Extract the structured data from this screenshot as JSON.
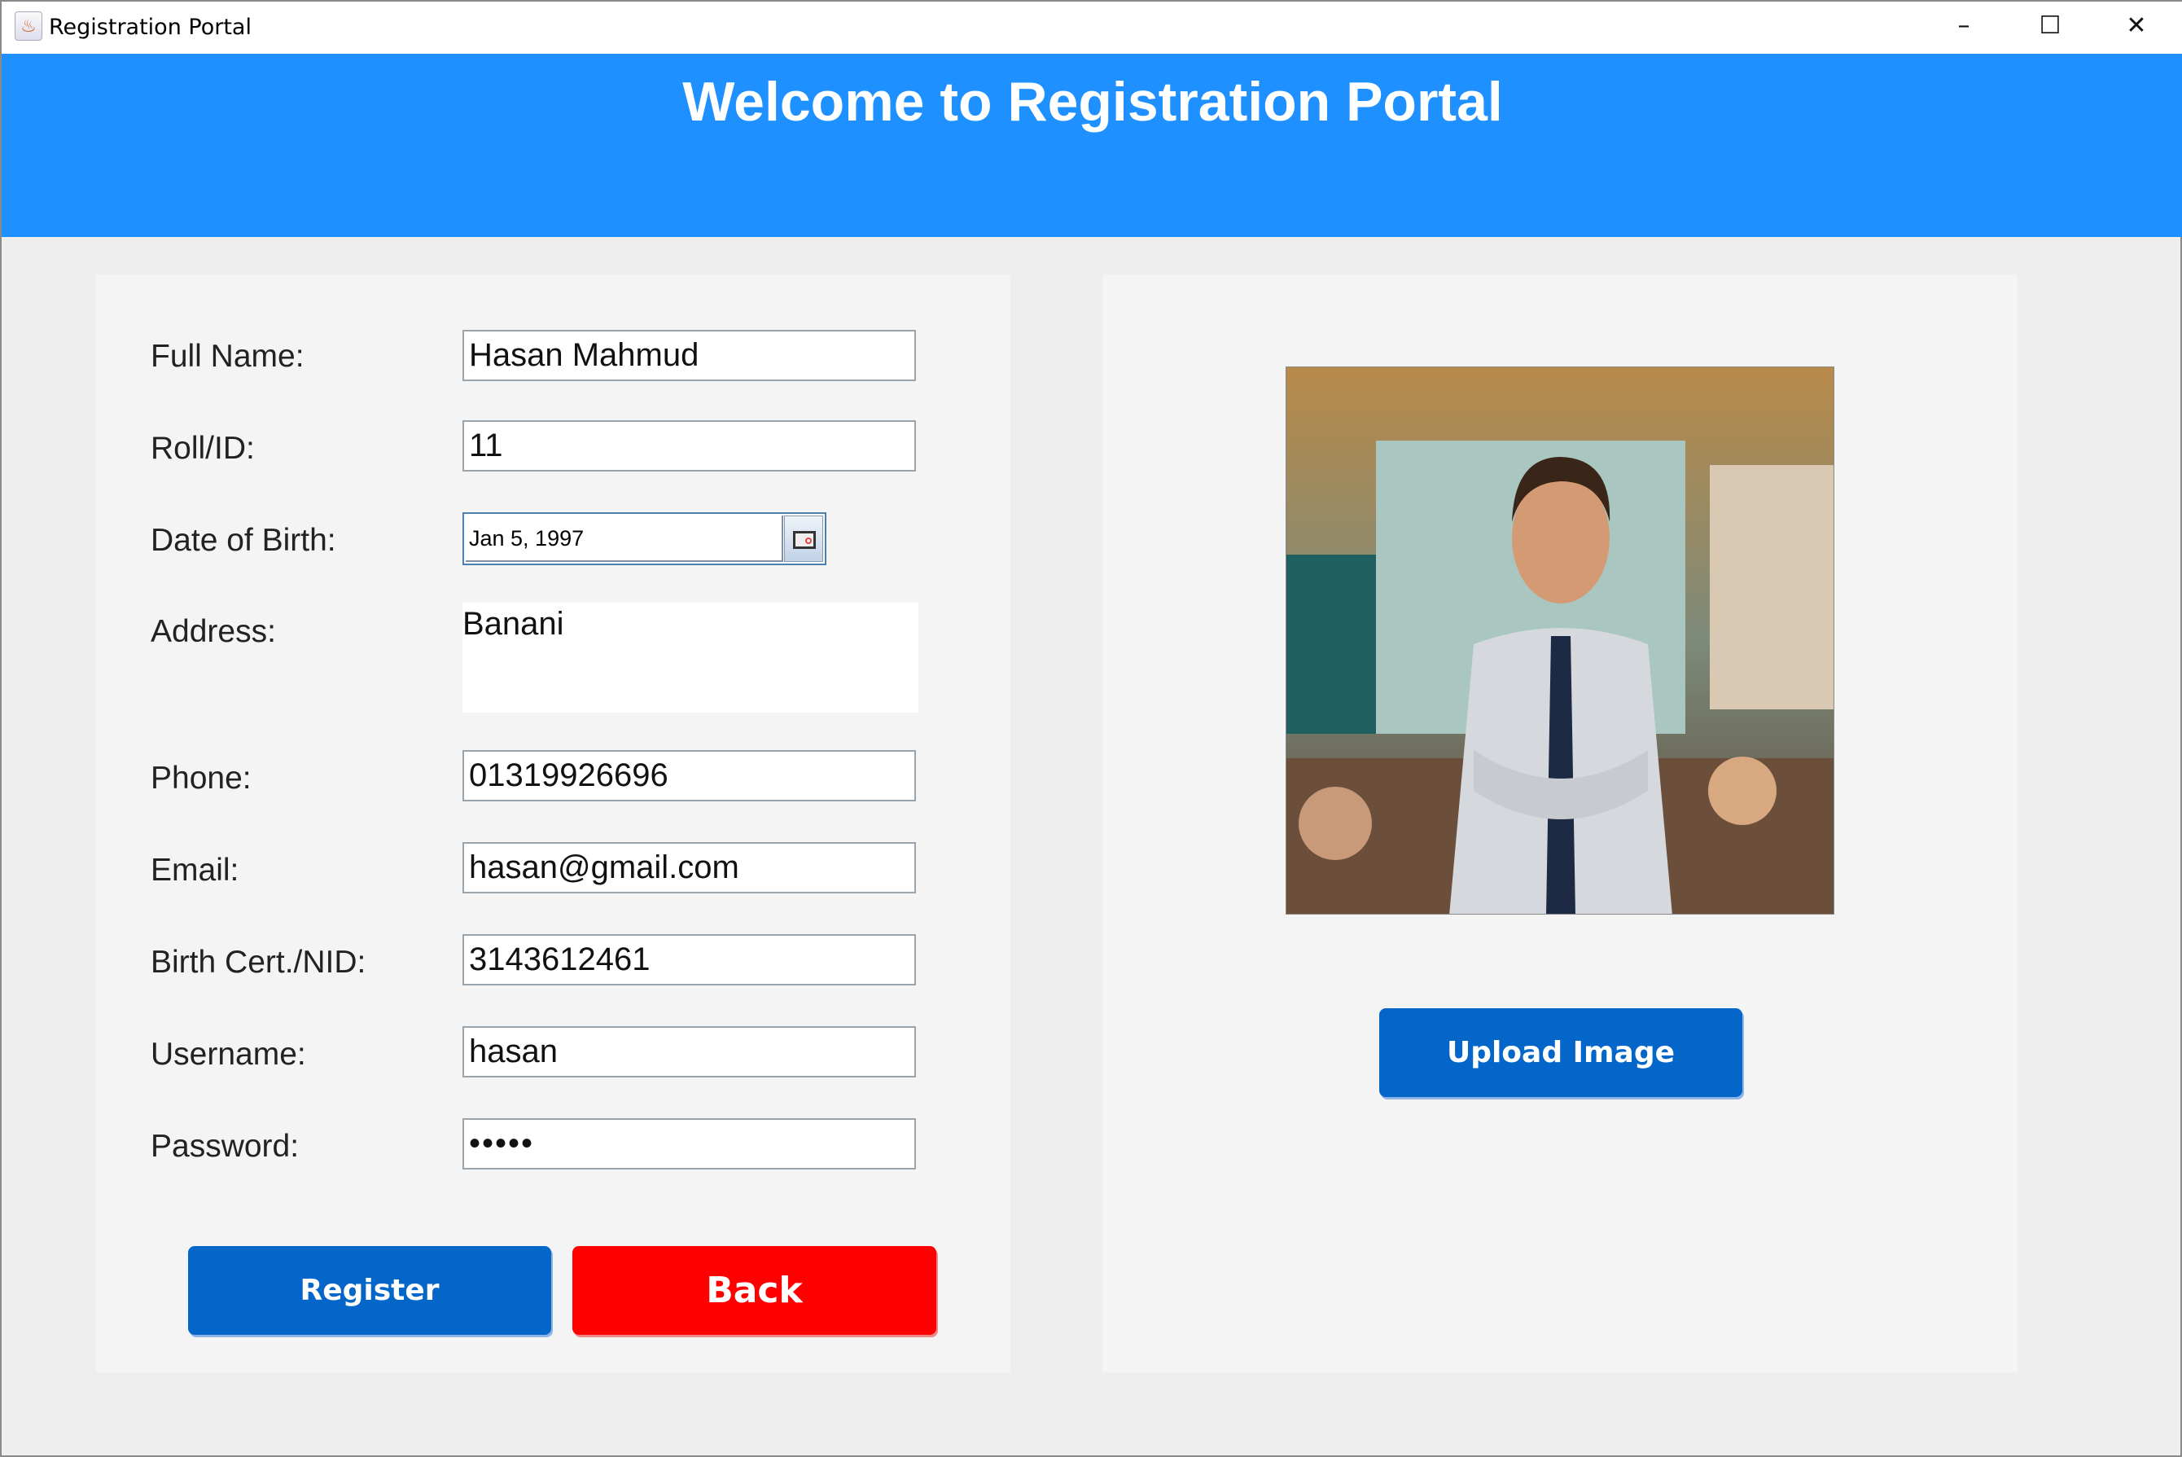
{
  "window": {
    "title": "Registration Portal",
    "controls": [
      "minimize",
      "maximize",
      "close"
    ]
  },
  "header": {
    "title": "Welcome to Registration Portal",
    "color": "#1e90ff"
  },
  "form": {
    "full_name": {
      "label": "Full Name:",
      "value": "Hasan Mahmud"
    },
    "roll": {
      "label": "Roll/ID:",
      "value": "11"
    },
    "dob": {
      "label": "Date of Birth:",
      "value": "Jan 5, 1997"
    },
    "address": {
      "label": "Address:",
      "value": "Banani"
    },
    "phone": {
      "label": "Phone:",
      "value": "01319926696"
    },
    "email": {
      "label": "Email:",
      "value": "hasan@gmail.com"
    },
    "nid": {
      "label": "Birth Cert./NID:",
      "value": "3143612461"
    },
    "username": {
      "label": "Username:",
      "value": "hasan"
    },
    "password": {
      "label": "Password:",
      "value": "•••••"
    },
    "register_label": "Register",
    "back_label": "Back"
  },
  "image_panel": {
    "upload_label": "Upload Image"
  },
  "colors": {
    "primary_button": "#0366c8",
    "back_button": "#ff0000"
  }
}
